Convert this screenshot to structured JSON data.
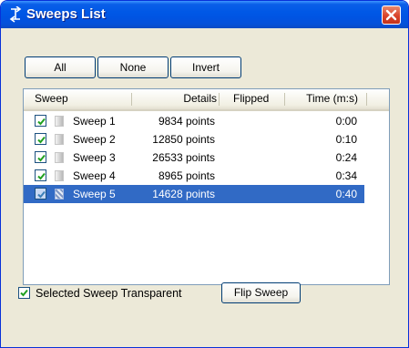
{
  "window": {
    "title": "Sweeps List",
    "close_glyph": "✕"
  },
  "selection_buttons": {
    "all": "All",
    "none": "None",
    "invert": "Invert"
  },
  "list": {
    "columns": {
      "sweep": "Sweep",
      "details": "Details",
      "flipped": "Flipped",
      "time": "Time (m:s)"
    },
    "rows": [
      {
        "name": "Sweep 1",
        "details": "9834 points",
        "flipped": "",
        "time": "0:00",
        "checked": true,
        "selected": false
      },
      {
        "name": "Sweep 2",
        "details": "12850 points",
        "flipped": "",
        "time": "0:10",
        "checked": true,
        "selected": false
      },
      {
        "name": "Sweep 3",
        "details": "26533 points",
        "flipped": "",
        "time": "0:24",
        "checked": true,
        "selected": false
      },
      {
        "name": "Sweep 4",
        "details": "8965 points",
        "flipped": "",
        "time": "0:34",
        "checked": true,
        "selected": false
      },
      {
        "name": "Sweep 5",
        "details": "14628 points",
        "flipped": "",
        "time": "0:40",
        "checked": true,
        "selected": true
      }
    ]
  },
  "options": {
    "transparent_label": "Selected Sweep Transparent",
    "transparent_checked": true,
    "flip_button": "Flip Sweep"
  },
  "colors": {
    "titlebar": "#0054e3",
    "selection": "#316ac5",
    "check": "#21a121",
    "close_button": "#d9432a"
  }
}
